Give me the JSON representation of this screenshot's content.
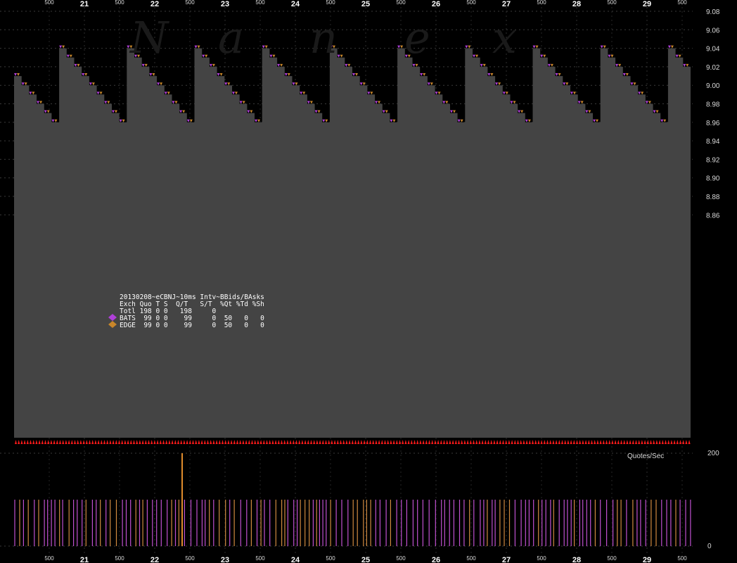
{
  "watermark": [
    "N",
    "a",
    "n",
    "e",
    "x"
  ],
  "stats_table": {
    "title": "20130208~eCBNJ~10ms Intv~BBids/BAsks",
    "header": "Exch Quo T S  Q/T   S/T  %Qt %Td %Sh",
    "rows": [
      {
        "text": "Totl 198 0 0   198     0",
        "color": ""
      },
      {
        "text": "BATS  99 0 0    99     0  50   0   0",
        "color": "#b040d8"
      },
      {
        "text": "EDGE  99 0 0    99     0  50   0   0",
        "color": "#c8862a"
      }
    ]
  },
  "volume_label": "Quotes/Sec",
  "chart_data": [
    {
      "type": "area",
      "title": "",
      "xlabel": "",
      "ylabel": "",
      "x_ticks_major": [
        "21",
        "22",
        "23",
        "24",
        "25",
        "26",
        "27",
        "28",
        "29"
      ],
      "x_ticks_minor": [
        "500",
        "500",
        "500",
        "500",
        "500",
        "500",
        "500",
        "500",
        "500",
        "500"
      ],
      "y_ticks": [
        "9.08",
        "9.06",
        "9.04",
        "9.02",
        "9.00",
        "8.98",
        "8.96",
        "8.94",
        "8.92",
        "8.90",
        "8.88",
        "8.86"
      ],
      "ylim": [
        8.85,
        9.08
      ],
      "grid": true,
      "series_colors": {
        "BATS": "#b040d8",
        "EDGE": "#c8862a"
      },
      "fill_color": "#444444",
      "cycle_pattern": [
        9.04,
        9.03,
        9.02,
        9.01,
        9.0,
        8.99,
        8.98,
        8.97,
        8.96
      ],
      "cycles": 11
    },
    {
      "type": "bar",
      "title": "",
      "ylabel": "Quotes/Sec",
      "y_ticks": [
        "200",
        "0"
      ],
      "ylim": [
        0,
        200
      ],
      "typical_value": 100,
      "spike_value": 200
    }
  ]
}
